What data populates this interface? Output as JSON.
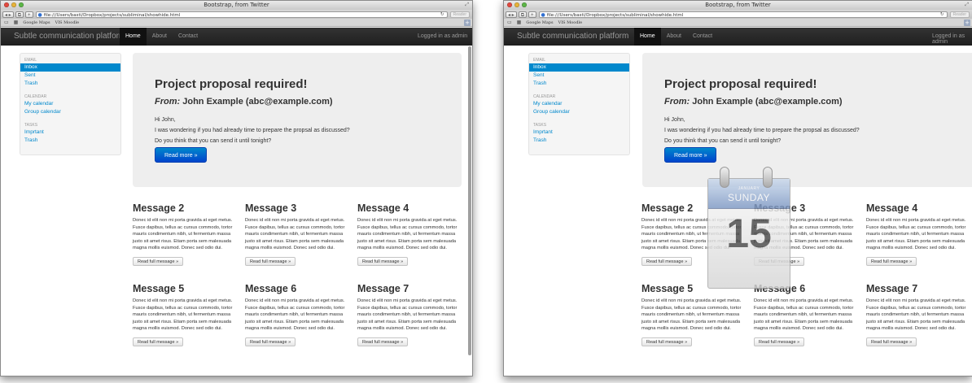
{
  "browser": {
    "window_title": "Bootstrap, from Twitter",
    "url": "file:///Users/basti/Dropbox/projects/subliminal/showhide.html",
    "reader_label": "Reader",
    "bookmarks": [
      "Google Maps",
      "VIS Moodle"
    ],
    "plus_label": "+"
  },
  "navbar": {
    "brand": "Subtle communication platform",
    "links": [
      {
        "label": "Home",
        "active": true
      },
      {
        "label": "About",
        "active": false
      },
      {
        "label": "Contact",
        "active": false
      }
    ],
    "status": "Logged in as admin"
  },
  "sidebar": {
    "sections": [
      {
        "header": "Email",
        "items": [
          "Inbox",
          "Sent",
          "Trash"
        ]
      },
      {
        "header": "Calendar",
        "items": [
          "My calendar",
          "Group calendar"
        ]
      },
      {
        "header": "Tasks",
        "items": [
          "Imprtant",
          "Trash"
        ]
      }
    ],
    "active_item": "Inbox"
  },
  "hero": {
    "title": "Project proposal required!",
    "from_label": "From:",
    "from_value": "John Example (abc@example.com)",
    "lines": [
      "Hi John,",
      "I was wondering if you had already time to prepare the propsal as discussed?",
      "Do you think that you can send it until tonight?"
    ],
    "button": "Read more »"
  },
  "messages": [
    {
      "title": "Message 2",
      "body": "Donec id elit non mi porta gravida at eget metus. Fusce dapibus, tellus ac cursus commodo, tortor mauris condimentum nibh, ut fermentum massa justo sit amet risus. Etiam porta sem malesuada magna mollis euismod. Donec sed odio dui.",
      "button": "Read full message »"
    },
    {
      "title": "Message 3",
      "body": "Donec id elit non mi porta gravida at eget metus. Fusce dapibus, tellus ac cursus commodo, tortor mauris condimentum nibh, ut fermentum massa justo sit amet risus. Etiam porta sem malesuada magna mollis euismod. Donec sed odio dui.",
      "button": "Read full message »"
    },
    {
      "title": "Message 4",
      "body": "Donec id elit non mi porta gravida at eget metus. Fusce dapibus, tellus ac cursus commodo, tortor mauris condimentum nibh, ut fermentum massa justo sit amet risus. Etiam porta sem malesuada magna mollis euismod. Donec sed odio dui.",
      "button": "Read full message »"
    },
    {
      "title": "Message 5",
      "body": "Donec id elit non mi porta gravida at eget metus. Fusce dapibus, tellus ac cursus commodo, tortor mauris condimentum nibh, ut fermentum massa justo sit amet risus. Etiam porta sem malesuada magna mollis euismod. Donec sed odio dui.",
      "button": "Read full message »"
    },
    {
      "title": "Message 6",
      "body": "Donec id elit non mi porta gravida at eget metus. Fusce dapibus, tellus ac cursus commodo, tortor mauris condimentum nibh, ut fermentum massa justo sit amet risus. Etiam porta sem malesuada magna mollis euismod. Donec sed odio dui.",
      "button": "Read full message »"
    },
    {
      "title": "Message 7",
      "body": "Donec id elit non mi porta gravida at eget metus. Fusce dapibus, tellus ac cursus commodo, tortor mauris condimentum nibh, ut fermentum massa justo sit amet risus. Etiam porta sem malesuada magna mollis euismod. Donec sed odio dui.",
      "button": "Read full message »"
    }
  ],
  "calendar_overlay": {
    "month": "JANUARY",
    "weekday": "SUNDAY",
    "date": "15"
  },
  "colors": {
    "link": "#0088cc",
    "navbar": "#222222",
    "hero_bg": "#eeeeee",
    "primary_button": "#0055cc"
  }
}
